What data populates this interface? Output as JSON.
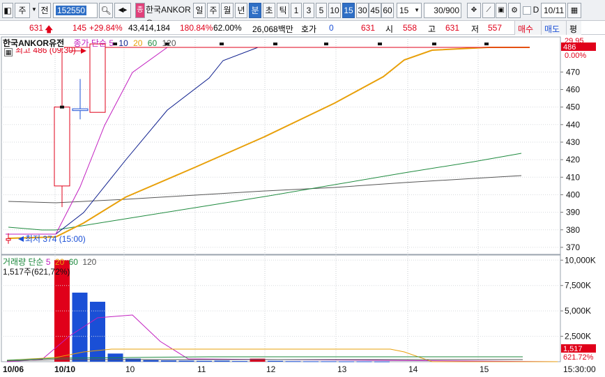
{
  "toolbar": {
    "period_tabs": [
      "주",
      "전"
    ],
    "code_value": "152550",
    "stock_name": "한국ANKOR유",
    "interval_tabs": [
      "일",
      "주",
      "월",
      "년",
      "분",
      "초",
      "틱"
    ],
    "minute_buttons": [
      "1",
      "3",
      "5",
      "10",
      "15",
      "30",
      "45",
      "60"
    ],
    "minute_select": "15",
    "count_value": "30",
    "count_max": "/900",
    "date_value": "10/11",
    "d_label": "D"
  },
  "infobar": {
    "price": "631",
    "change": "145",
    "change_pct": "+29.84%",
    "volume": "43,414,184",
    "volume_ratio": "180.84%",
    "rate": "62.00%",
    "amount": "26,068백만",
    "hoga_label": "호가",
    "hoga_value": "0",
    "ask_value": "631",
    "open_label": "시",
    "open_value": "558",
    "high_label": "고",
    "high_value": "631",
    "low_label": "저",
    "low_value": "557",
    "buy_button": "매수",
    "sell_button": "매도",
    "avg_button": "평"
  },
  "price_chart": {
    "title": "한국ANKOR유전",
    "legend_name": "종가 단순",
    "legend_periods": [
      "5",
      "10",
      "20",
      "60",
      "120"
    ],
    "legend_colors": [
      "#c21fc0",
      "#0b1c8c",
      "#e8a00a",
      "#1e8a3e",
      "#555555"
    ],
    "high_annotation": "최고 486 (09:30)",
    "low_annotation": "최저 374 (15:00)",
    "y_ticks": [
      "470",
      "460",
      "450",
      "440",
      "430",
      "420",
      "410",
      "400",
      "390",
      "380",
      "370"
    ],
    "right_top_value": "29.95",
    "right_price_badge": "486",
    "right_pct": "0.00%"
  },
  "volume_chart": {
    "legend_name": "거래량 단순",
    "legend_periods": [
      "5",
      "20",
      "60",
      "120"
    ],
    "legend_colors": [
      "#c21fc0",
      "#e8a00a",
      "#1e8a3e",
      "#555555"
    ],
    "value_note": "1,517주(621,72%)",
    "y_ticks": [
      "10,000K",
      "7,500K",
      "5,000K",
      "2,500K"
    ],
    "right_badge": "1,517",
    "right_pct": "621.72%"
  },
  "x_axis": {
    "labels": [
      "10/06",
      "10/10",
      "10",
      "11",
      "12",
      "13",
      "14",
      "15"
    ],
    "right_time": "15:30:00"
  },
  "colors": {
    "up": "#e0001a",
    "down": "#1a4fd6",
    "selected_button": "#2f6fc6"
  },
  "chart_data": {
    "type": "candlestick",
    "candles": [
      {
        "o": 374,
        "h": 378,
        "l": 372,
        "c": 375
      },
      {
        "o": 405,
        "h": 486,
        "l": 393,
        "c": 450
      },
      {
        "o": 449,
        "h": 466,
        "l": 443,
        "c": 448
      },
      {
        "o": 447,
        "h": 486,
        "l": 447,
        "c": 486
      },
      {
        "o": 486,
        "h": 486,
        "l": 486,
        "c": 486
      },
      {
        "o": 486,
        "h": 486,
        "l": 486,
        "c": 486
      },
      {
        "o": 486,
        "h": 486,
        "l": 486,
        "c": 486
      },
      {
        "o": 486,
        "h": 486,
        "l": 486,
        "c": 486
      },
      {
        "o": 486,
        "h": 486,
        "l": 486,
        "c": 486
      },
      {
        "o": 486,
        "h": 486,
        "l": 486,
        "c": 486
      },
      {
        "o": 486,
        "h": 486,
        "l": 486,
        "c": 486
      },
      {
        "o": 486,
        "h": 486,
        "l": 486,
        "c": 486
      }
    ],
    "volumes_k": [
      0,
      10000,
      6800,
      5900,
      800,
      300,
      150,
      120,
      100,
      80,
      100,
      60,
      300,
      80,
      50,
      40,
      40,
      30,
      30,
      20
    ],
    "volume_colors": [
      "#e0001a",
      "#e0001a",
      "#1a4fd6",
      "#1a4fd6",
      "#1a4fd6",
      "#1a4fd6",
      "#1a4fd6",
      "#1a4fd6",
      "#1a4fd6",
      "#1a4fd6",
      "#1a4fd6",
      "#1a4fd6",
      "#e0001a",
      "#1a4fd6",
      "#1a4fd6",
      "#1a4fd6",
      "#1a4fd6",
      "#1a4fd6",
      "#1a4fd6",
      "#1a4fd6"
    ],
    "ylim_price": [
      366,
      490
    ],
    "ylim_volume": [
      0,
      10500
    ]
  }
}
